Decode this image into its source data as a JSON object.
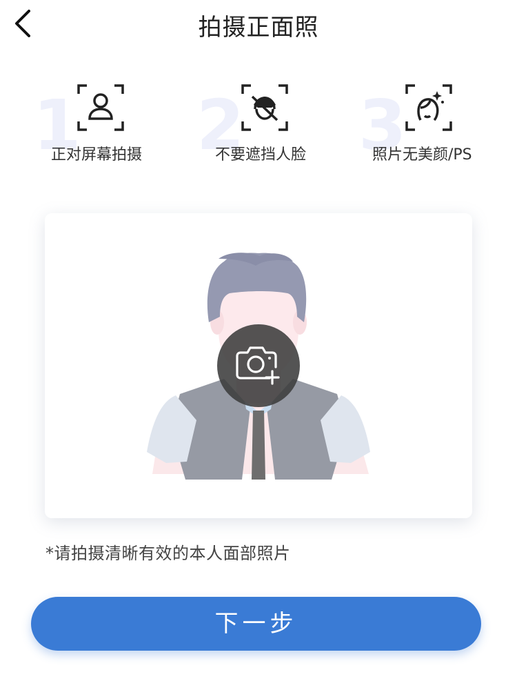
{
  "header": {
    "title": "拍摄正面照",
    "back_icon": "chevron-left-icon"
  },
  "tips": [
    {
      "number": "1",
      "label": "正对屏幕拍摄",
      "icon": "face-frame-person-icon"
    },
    {
      "number": "2",
      "label": "不要遮挡人脸",
      "icon": "face-frame-no-cover-icon"
    },
    {
      "number": "3",
      "label": "照片无美颜/PS",
      "icon": "face-frame-no-beauty-icon"
    }
  ],
  "photo_card": {
    "camera_icon": "camera-add-icon"
  },
  "hint": "*请拍摄清晰有效的本人面部照片",
  "next_button": {
    "label": "下一步"
  },
  "colors": {
    "primary": "#3a7bd5",
    "tip_number": "#eef0fb",
    "text": "#222222"
  }
}
